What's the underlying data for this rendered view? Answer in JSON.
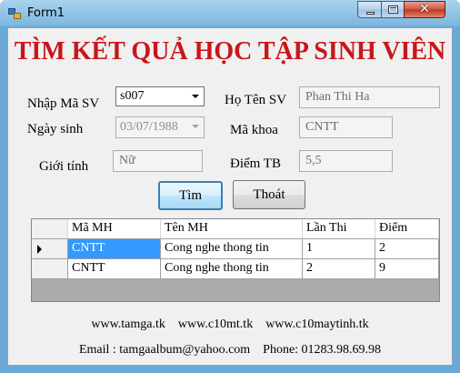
{
  "window": {
    "title": "Form1"
  },
  "heading": "TÌM KẾT QUẢ HỌC TẬP SINH VIÊN",
  "form": {
    "student_id_label": "Nhập Mã SV",
    "student_id_value": "s007",
    "name_label": "Họ Tên SV",
    "name_value": "Phan Thi Ha",
    "dob_label": "Ngày sinh",
    "dob_value": "03/07/1988",
    "faculty_label": "Mã khoa",
    "faculty_value": "CNTT",
    "gender_label": "Giới tính",
    "gender_value": "Nữ",
    "gpa_label": "Điểm TB",
    "gpa_value": "5,5"
  },
  "buttons": {
    "search": "Tìm",
    "exit": "Thoát"
  },
  "grid": {
    "columns": [
      "Mã MH",
      "Tên MH",
      "Lần Thi",
      "Điểm"
    ],
    "rows": [
      [
        "CNTT",
        "Cong nghe thong tin",
        "1",
        "2"
      ],
      [
        "CNTT",
        "Cong nghe thong tin",
        "2",
        "9"
      ]
    ]
  },
  "footer": {
    "links": "www.tamga.tk    www.c10mt.tk    www.c10maytinh.tk",
    "contact": "Email : tamgaalbum@yahoo.com    Phone: 01283.98.69.98"
  },
  "colors": {
    "heading": "#c8161b",
    "selection": "#3399ff"
  }
}
